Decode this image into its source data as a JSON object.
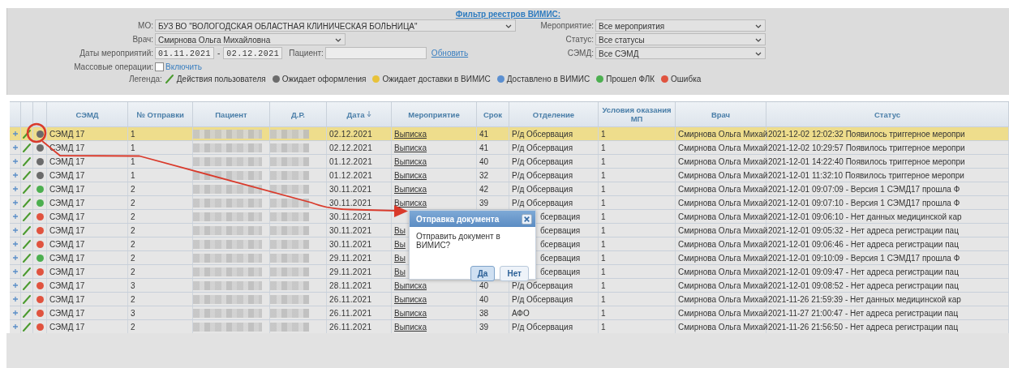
{
  "filter": {
    "title": "Фильтр реестров ВИМИС:",
    "mo": {
      "label": "МО:",
      "value": "БУЗ ВО \"ВОЛОГОДСКАЯ ОБЛАСТНАЯ КЛИНИЧЕСКАЯ БОЛЬНИЦА\""
    },
    "doctor": {
      "label": "Врач:",
      "value": "Смирнова Ольга Михайловна"
    },
    "dates": {
      "label": "Даты мероприятий:",
      "from": "01.11.2021",
      "separator": "-",
      "to": "02.12.2021"
    },
    "patient": {
      "label": "Пациент:"
    },
    "refresh": "Обновить",
    "event": {
      "label": "Мероприятие:",
      "value": "Все мероприятия"
    },
    "status": {
      "label": "Статус:",
      "value": "Все статусы"
    },
    "semd": {
      "label": "СЭМД:",
      "value": "Все СЭМД"
    },
    "mass": {
      "label": "Массовые операции:",
      "checked": false,
      "link": "Включить"
    },
    "legend": {
      "label": "Легенда:",
      "items": [
        {
          "kind": "pencil",
          "text": "Действия пользователя"
        },
        {
          "kind": "dot",
          "color": "#6b6b6b",
          "text": "Ожидает оформления"
        },
        {
          "kind": "dot",
          "color": "#e8c23a",
          "text": "Ожидает доставки в ВИМИС"
        },
        {
          "kind": "dot",
          "color": "#5b8fd0",
          "text": "Доставлено в ВИМИС"
        },
        {
          "kind": "dot",
          "color": "#4caf50",
          "text": "Прошел ФЛК"
        },
        {
          "kind": "dot",
          "color": "#e0533f",
          "text": "Ошибка"
        }
      ]
    }
  },
  "table": {
    "columns": [
      {
        "label": "СЭМД"
      },
      {
        "label": "№ Отправки"
      },
      {
        "label": "Пациент"
      },
      {
        "label": "Д.Р."
      },
      {
        "label": "Дата",
        "sorted": true
      },
      {
        "label": "Мероприятие"
      },
      {
        "label": "Срок"
      },
      {
        "label": "Отделение"
      },
      {
        "label": "Условия оказания МП"
      },
      {
        "label": "Врач"
      },
      {
        "label": "Статус"
      }
    ],
    "rows": [
      {
        "selected": true,
        "color": "#6b6b6b",
        "semd": "СЭМД 17",
        "send_no": "1",
        "date": "02.12.2021",
        "event": "Выписка",
        "term": "41",
        "department": "Р/д Обсервация",
        "conditions": "1",
        "doctor": "Смирнова Ольга Михай",
        "status": "2021-12-02 12:02:32 Появилось триггерное меропри"
      },
      {
        "selected": false,
        "color": "#6b6b6b",
        "semd": "СЭМД 17",
        "send_no": "1",
        "date": "02.12.2021",
        "event": "Выписка",
        "term": "41",
        "department": "Р/д Обсервация",
        "conditions": "1",
        "doctor": "Смирнова Ольга Михай",
        "status": "2021-12-02 10:29:57 Появилось триггерное меропри"
      },
      {
        "selected": false,
        "color": "#6b6b6b",
        "semd": "СЭМД 17",
        "send_no": "1",
        "date": "01.12.2021",
        "event": "Выписка",
        "term": "40",
        "department": "Р/д Обсервация",
        "conditions": "1",
        "doctor": "Смирнова Ольга Михай",
        "status": "2021-12-01 14:22:40 Появилось триггерное меропри"
      },
      {
        "selected": false,
        "color": "#6b6b6b",
        "semd": "СЭМД 17",
        "send_no": "1",
        "date": "01.12.2021",
        "event": "Выписка",
        "term": "32",
        "department": "Р/д Обсервация",
        "conditions": "1",
        "doctor": "Смирнова Ольга Михай",
        "status": "2021-12-01 11:32:10 Появилось триггерное меропри"
      },
      {
        "selected": false,
        "color": "#4caf50",
        "semd": "СЭМД 17",
        "send_no": "2",
        "date": "30.11.2021",
        "event": "Выписка",
        "term": "42",
        "department": "Р/д Обсервация",
        "conditions": "1",
        "doctor": "Смирнова Ольга Михай",
        "status": "2021-12-01 09:07:09 - Версия 1 СЭМД17 прошла Ф"
      },
      {
        "selected": false,
        "color": "#4caf50",
        "semd": "СЭМД 17",
        "send_no": "2",
        "date": "30.11.2021",
        "event": "Выписка",
        "term": "39",
        "department": "Р/д Обсервация",
        "conditions": "1",
        "doctor": "Смирнова Ольга Михай",
        "status": "2021-12-01 09:07:10 - Версия 1 СЭМД17 прошла Ф"
      },
      {
        "selected": false,
        "under_dialog": true,
        "color": "#e0533f",
        "semd": "СЭМД 17",
        "send_no": "2",
        "date": "30.11.2021",
        "department": "бсервация",
        "conditions": "1",
        "doctor": "Смирнова Ольга Михай",
        "status": "2021-12-01 09:06:10 - Нет данных медицинской кар"
      },
      {
        "selected": false,
        "under_dialog": true,
        "color": "#e0533f",
        "semd": "СЭМД 17",
        "send_no": "2",
        "date": "30.11.2021",
        "event": "Вы",
        "department": "бсервация",
        "conditions": "1",
        "doctor": "Смирнова Ольга Михай",
        "status": "2021-12-01 09:05:32 - Нет адреса регистрации пац"
      },
      {
        "selected": false,
        "under_dialog": true,
        "color": "#e0533f",
        "semd": "СЭМД 17",
        "send_no": "2",
        "date": "30.11.2021",
        "event": "Вы",
        "department": "бсервация",
        "conditions": "1",
        "doctor": "Смирнова Ольга Михай",
        "status": "2021-12-01 09:06:46 - Нет адреса регистрации пац"
      },
      {
        "selected": false,
        "under_dialog": true,
        "color": "#4caf50",
        "semd": "СЭМД 17",
        "send_no": "2",
        "date": "29.11.2021",
        "event": "Вы",
        "department": "бсервация",
        "conditions": "1",
        "doctor": "Смирнова Ольга Михай",
        "status": "2021-12-01 09:10:09 - Версия 1 СЭМД17 прошла Ф"
      },
      {
        "selected": false,
        "under_dialog": true,
        "color": "#e0533f",
        "semd": "СЭМД 17",
        "send_no": "2",
        "date": "29.11.2021",
        "event": "Вы",
        "department": "бсервация",
        "conditions": "1",
        "doctor": "Смирнова Ольга Михай",
        "status": "2021-12-01 09:09:47 - Нет адреса регистрации пац"
      },
      {
        "selected": false,
        "color": "#e0533f",
        "semd": "СЭМД 17",
        "send_no": "3",
        "date": "28.11.2021",
        "event": "Выписка",
        "term": "40",
        "department": "Р/д Обсервация",
        "conditions": "1",
        "doctor": "Смирнова Ольга Михай",
        "status": "2021-12-01 09:08:52 - Нет адреса регистрации пац"
      },
      {
        "selected": false,
        "color": "#e0533f",
        "semd": "СЭМД 17",
        "send_no": "2",
        "date": "26.11.2021",
        "event": "Выписка",
        "term": "40",
        "department": "Р/д Обсервация",
        "conditions": "1",
        "doctor": "Смирнова Ольга Михай",
        "status": "2021-11-26 21:59:39 - Нет данных медицинской кар"
      },
      {
        "selected": false,
        "color": "#e0533f",
        "semd": "СЭМД 17",
        "send_no": "3",
        "date": "26.11.2021",
        "event": "Выписка",
        "term": "38",
        "department": "АФО",
        "conditions": "1",
        "doctor": "Смирнова Ольга Михай",
        "status": "2021-11-27 21:00:47 - Нет адреса регистрации пац"
      },
      {
        "selected": false,
        "color": "#e0533f",
        "semd": "СЭМД 17",
        "send_no": "2",
        "date": "26.11.2021",
        "event": "Выписка",
        "term": "39",
        "department": "Р/д Обсервация",
        "conditions": "1",
        "doctor": "Смирнова Ольга Михай",
        "status": "2021-11-26 21:56:50 - Нет адреса регистрации пац"
      }
    ]
  },
  "dialog": {
    "title": "Отправка документа",
    "message": "Отправить документ в ВИМИС?",
    "buttons": [
      {
        "label": "Да",
        "selected": true
      },
      {
        "label": "Нет",
        "selected": false
      }
    ]
  }
}
